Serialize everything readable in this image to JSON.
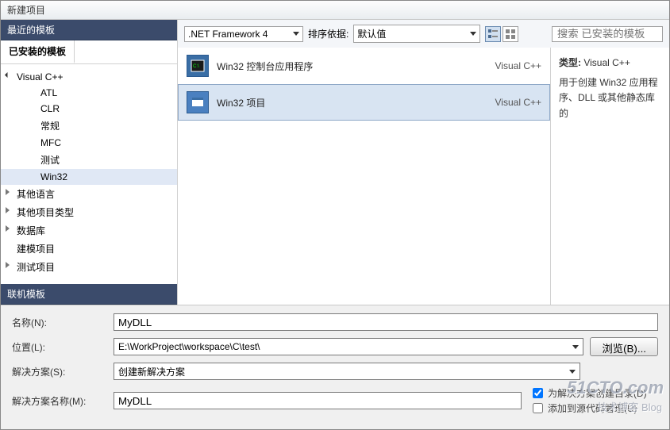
{
  "window": {
    "title": "新建项目"
  },
  "sidebar": {
    "recent_header": "最近的模板",
    "installed_tab": "已安装的模板",
    "online_header": "联机模板",
    "tree": [
      {
        "label": "Visual C++",
        "level": 1,
        "expanded": true
      },
      {
        "label": "ATL",
        "level": 2
      },
      {
        "label": "CLR",
        "level": 2
      },
      {
        "label": "常规",
        "level": 2
      },
      {
        "label": "MFC",
        "level": 2
      },
      {
        "label": "测试",
        "level": 2
      },
      {
        "label": "Win32",
        "level": 2,
        "selected": true
      },
      {
        "label": "其他语言",
        "level": 1,
        "expanded": false
      },
      {
        "label": "其他项目类型",
        "level": 1,
        "expanded": false
      },
      {
        "label": "数据库",
        "level": 1,
        "expanded": false
      },
      {
        "label": "建模项目",
        "level": 1
      },
      {
        "label": "测试项目",
        "level": 1,
        "expanded": false
      }
    ]
  },
  "toolbar": {
    "framework": ".NET Framework 4",
    "sort_label": "排序依据:",
    "sort_value": "默认值",
    "search_placeholder": "搜索 已安装的模板"
  },
  "templates": [
    {
      "name": "Win32 控制台应用程序",
      "type": "Visual C++",
      "selected": false
    },
    {
      "name": "Win32 项目",
      "type": "Visual C++",
      "selected": true
    }
  ],
  "description": {
    "type_label": "类型:",
    "type_value": "Visual C++",
    "body": "用于创建 Win32 应用程序、DLL 或其他静态库的"
  },
  "form": {
    "name_label": "名称(N):",
    "name_value": "MyDLL",
    "location_label": "位置(L):",
    "location_value": "E:\\WorkProject\\workspace\\C\\test\\",
    "browse_label": "浏览(B)...",
    "solution_label": "解决方案(S):",
    "solution_value": "创建新解决方案",
    "solution_name_label": "解决方案名称(M):",
    "solution_name_value": "MyDLL",
    "chk1_label": "为解决方案创建目录(D)",
    "chk2_label": "添加到源代码管理(U)"
  },
  "watermark": {
    "main": "51CTO.com",
    "sub": "技术博客  Blog"
  }
}
